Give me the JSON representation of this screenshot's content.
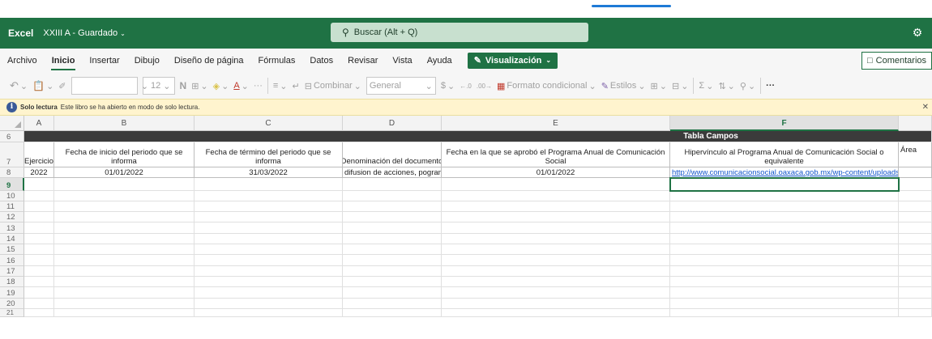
{
  "app": {
    "name": "Excel",
    "doc_title": "XXIII A - Guardado",
    "search_placeholder": "Buscar (Alt + Q)"
  },
  "menu": {
    "items": [
      "Archivo",
      "Inicio",
      "Insertar",
      "Dibujo",
      "Diseño de página",
      "Fórmulas",
      "Datos",
      "Revisar",
      "Vista",
      "Ayuda"
    ],
    "active": "Inicio",
    "visualizacion_label": "Visualización",
    "comments_label": "Comentarios"
  },
  "toolbar": {
    "font_size": "12",
    "bold_glyph": "N",
    "number_format": "General",
    "merge_label": "Combinar",
    "conditional_label": "Formato condicional",
    "styles_label": "Estilos",
    "more": "···"
  },
  "readonly_bar": {
    "title": "Solo lectura",
    "message": "Este libro se ha abierto en modo de solo lectura."
  },
  "sheet": {
    "columns": [
      "A",
      "B",
      "C",
      "D",
      "E",
      "F"
    ],
    "selected_column": "F",
    "rows": [
      "6",
      "7",
      "8",
      "9",
      "10",
      "11",
      "12",
      "13",
      "14",
      "15",
      "16",
      "17",
      "18",
      "19",
      "20",
      "21"
    ],
    "selected_row": "9",
    "row6_title": "Tabla Campos",
    "headers": [
      "Ejercicio",
      "Fecha de inicio del periodo que se informa",
      "Fecha de término del periodo que se informa",
      "Denominación del documento",
      "Fecha en la que se aprobó el Programa Anual de Comunicación Social",
      "Hipervínculo al Programa Anual de Comunicación Social o equivalente",
      "Área"
    ],
    "data_row": [
      "2022",
      "01/01/2022",
      "31/03/2022",
      "difusion de acciones, pograma",
      "01/01/2022",
      "http://www.comunicacionsocial.oaxaca.gob.mx/wp-content/uploads/"
    ]
  },
  "colors": {
    "excel_green": "#1f7244",
    "header_dark": "#3b3b3b",
    "readonly_bg": "#fff4ce",
    "link": "#1155cc"
  }
}
